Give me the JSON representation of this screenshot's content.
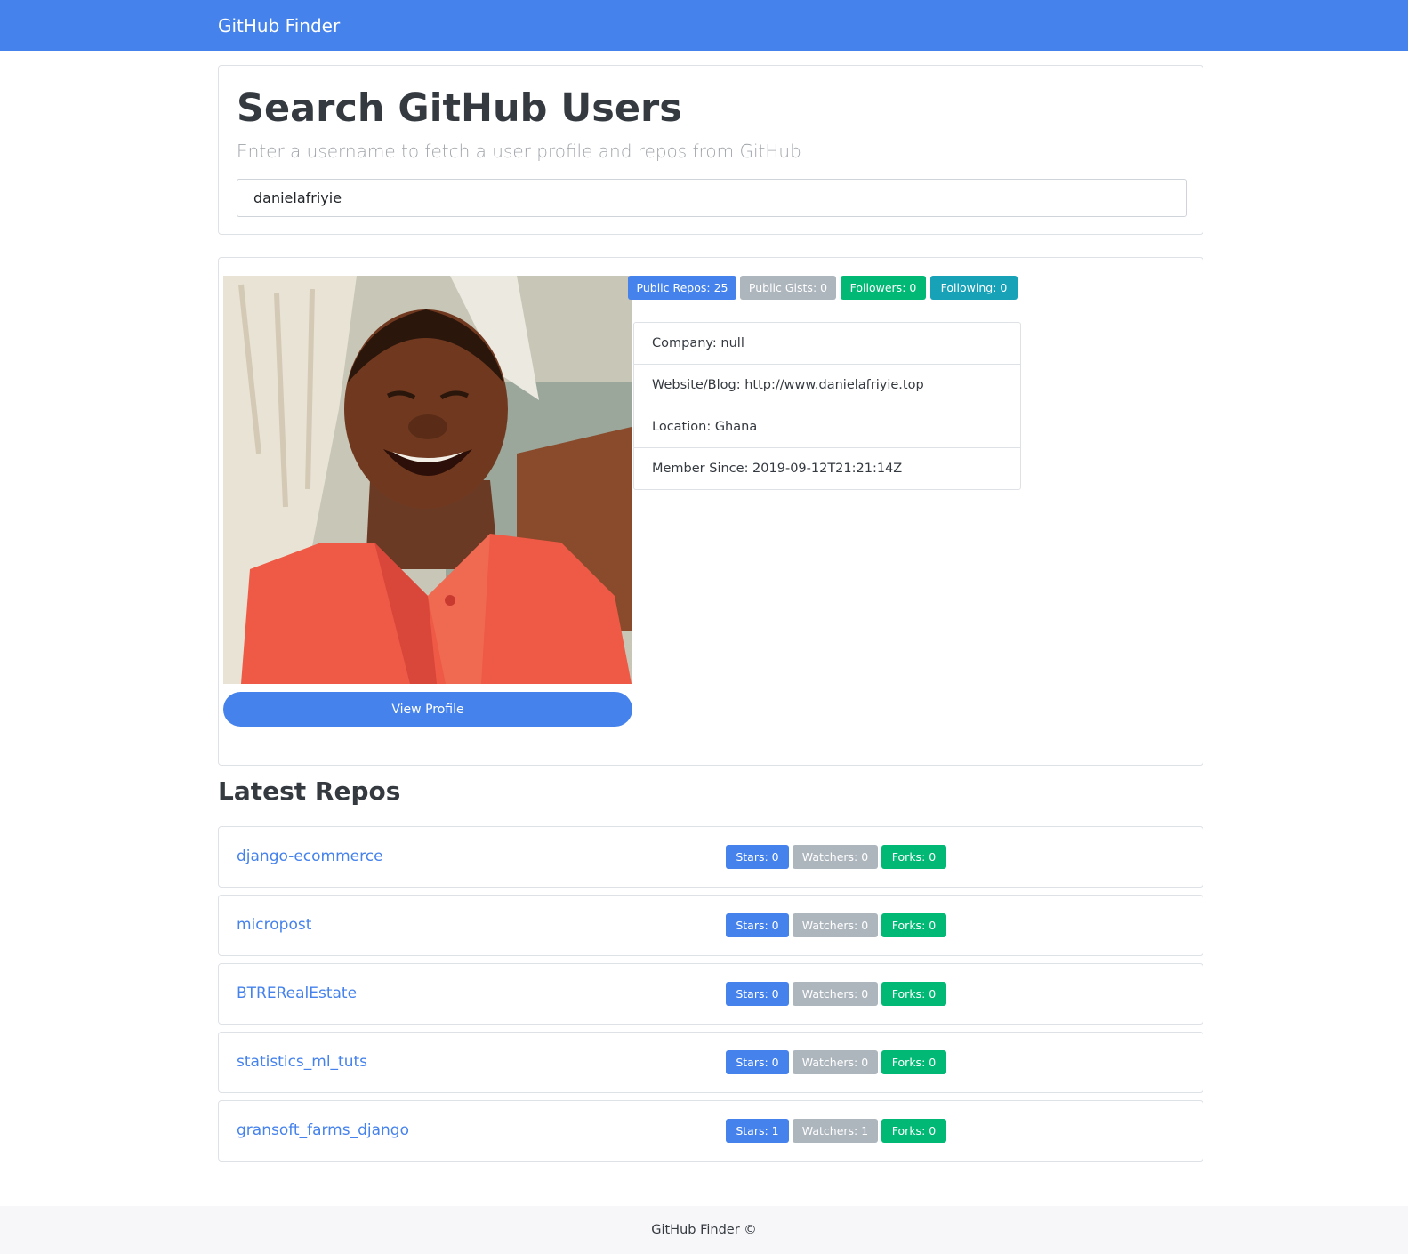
{
  "navbar": {
    "brand": "GitHub Finder"
  },
  "search": {
    "heading": "Search GitHub Users",
    "lead": "Enter a username to fetch a user profile and repos from GitHub",
    "value": "danielafriyie"
  },
  "profile": {
    "avatar_description": "user avatar photo",
    "view_profile_label": "View Profile",
    "badges": {
      "public_repos": "Public Repos: 25",
      "public_gists": "Public Gists: 0",
      "followers": "Followers: 0",
      "following": "Following: 0"
    },
    "details": {
      "company": "Company: null",
      "website": "Website/Blog: http://www.danielafriyie.top",
      "location": "Location: Ghana",
      "member_since": "Member Since: 2019-09-12T21:21:14Z"
    }
  },
  "repos": {
    "title": "Latest Repos",
    "items": [
      {
        "name": "django-ecommerce",
        "stars": "Stars: 0",
        "watchers": "Watchers: 0",
        "forks": "Forks: 0"
      },
      {
        "name": "micropost",
        "stars": "Stars: 0",
        "watchers": "Watchers: 0",
        "forks": "Forks: 0"
      },
      {
        "name": "BTRERealEstate",
        "stars": "Stars: 0",
        "watchers": "Watchers: 0",
        "forks": "Forks: 0"
      },
      {
        "name": "statistics_ml_tuts",
        "stars": "Stars: 0",
        "watchers": "Watchers: 0",
        "forks": "Forks: 0"
      },
      {
        "name": "gransoft_farms_django",
        "stars": "Stars: 1",
        "watchers": "Watchers: 1",
        "forks": "Forks: 0"
      }
    ]
  },
  "footer": {
    "text": "GitHub Finder ©"
  },
  "colors": {
    "primary": "#4582ec",
    "secondary": "#adb5bd",
    "success": "#02b875",
    "info": "#17a2b8",
    "footer_bg": "#f7f7f9"
  }
}
